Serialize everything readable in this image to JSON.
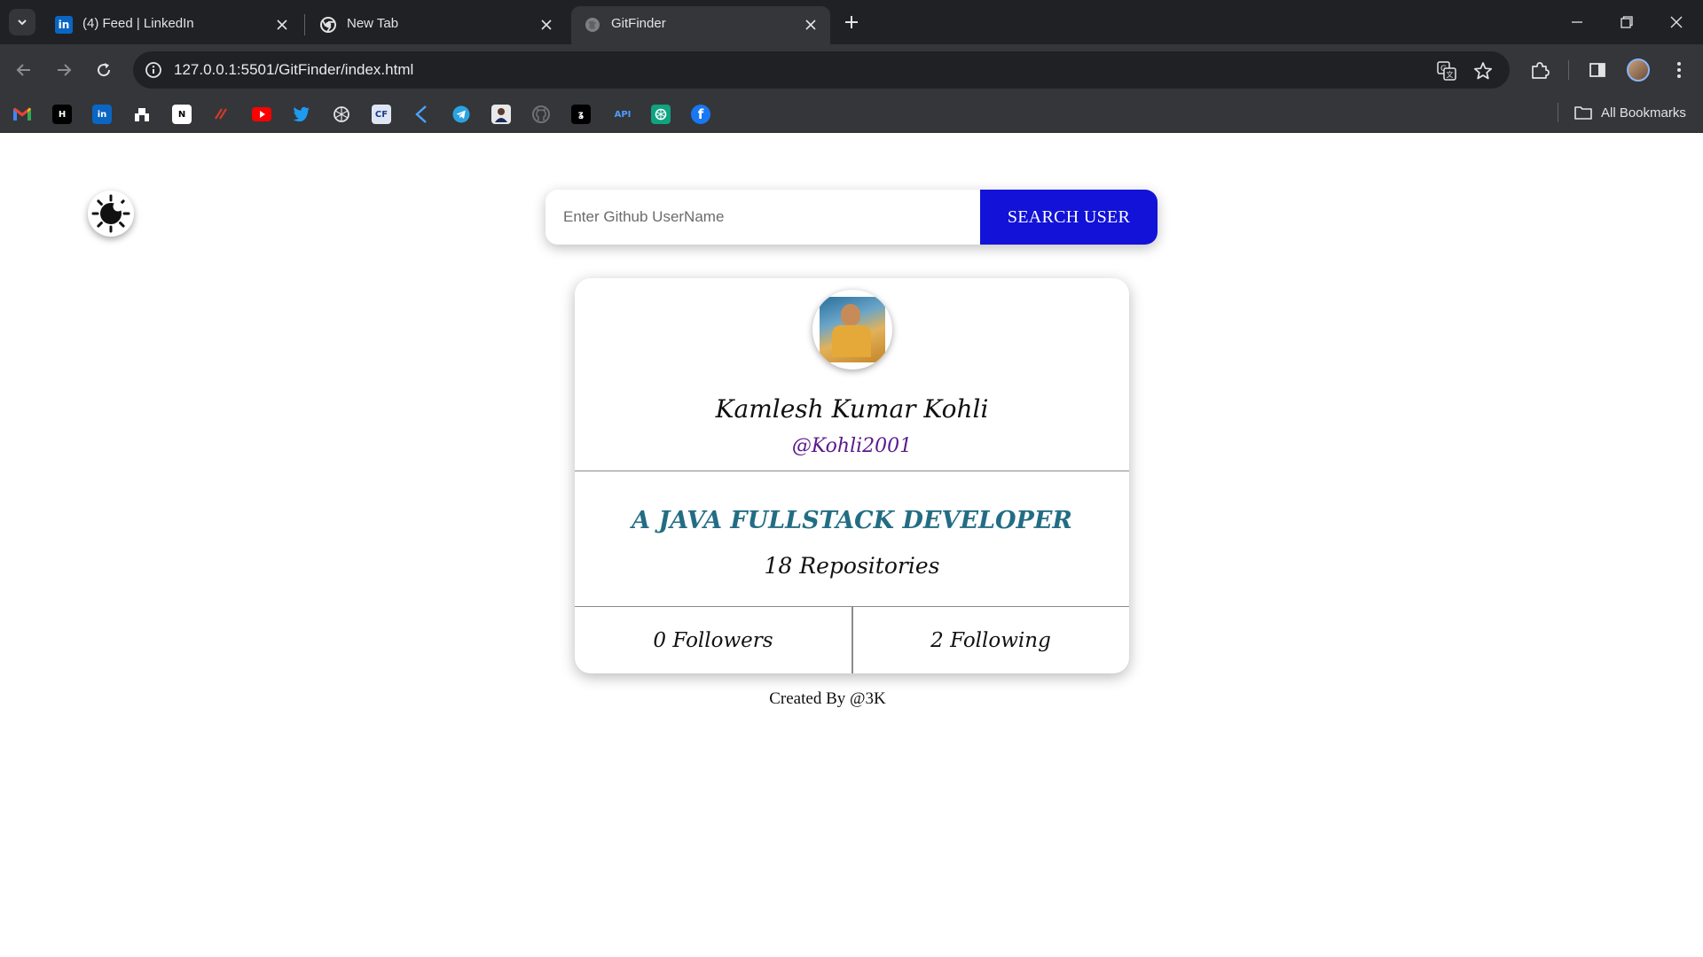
{
  "browser": {
    "tabs": [
      {
        "title": "(4) Feed | LinkedIn",
        "icon": "linkedin-icon"
      },
      {
        "title": "New Tab",
        "icon": "chrome-icon"
      },
      {
        "title": "GitFinder",
        "icon": "globe-icon",
        "active": true
      }
    ],
    "url": "127.0.0.1:5501/GitFinder/index.html",
    "bookmarks": [
      "gmail",
      "hackerrank",
      "linkedin",
      "unstop",
      "notion",
      "leetcode",
      "youtube",
      "twitter",
      "chatgpt",
      "codeforces",
      "kotlin",
      "telegram",
      "profile",
      "github",
      "codechef",
      "api",
      "openai",
      "facebook"
    ],
    "api_label": "API",
    "all_bookmarks": "All Bookmarks"
  },
  "page": {
    "search": {
      "placeholder": "Enter Github UserName",
      "button_label": "SEARCH USER"
    },
    "profile": {
      "name": "Kamlesh Kumar Kohli",
      "login": "@Kohli2001",
      "bio": "A JAVA FULLSTACK DEVELOPER",
      "repositories": "18 Repositories",
      "followers": "0 Followers",
      "following": "2 Following"
    },
    "footer": "Created By @3K"
  },
  "colors": {
    "search_button": "#1212d8",
    "login": "#5a1a8c",
    "bio": "#236d84"
  }
}
